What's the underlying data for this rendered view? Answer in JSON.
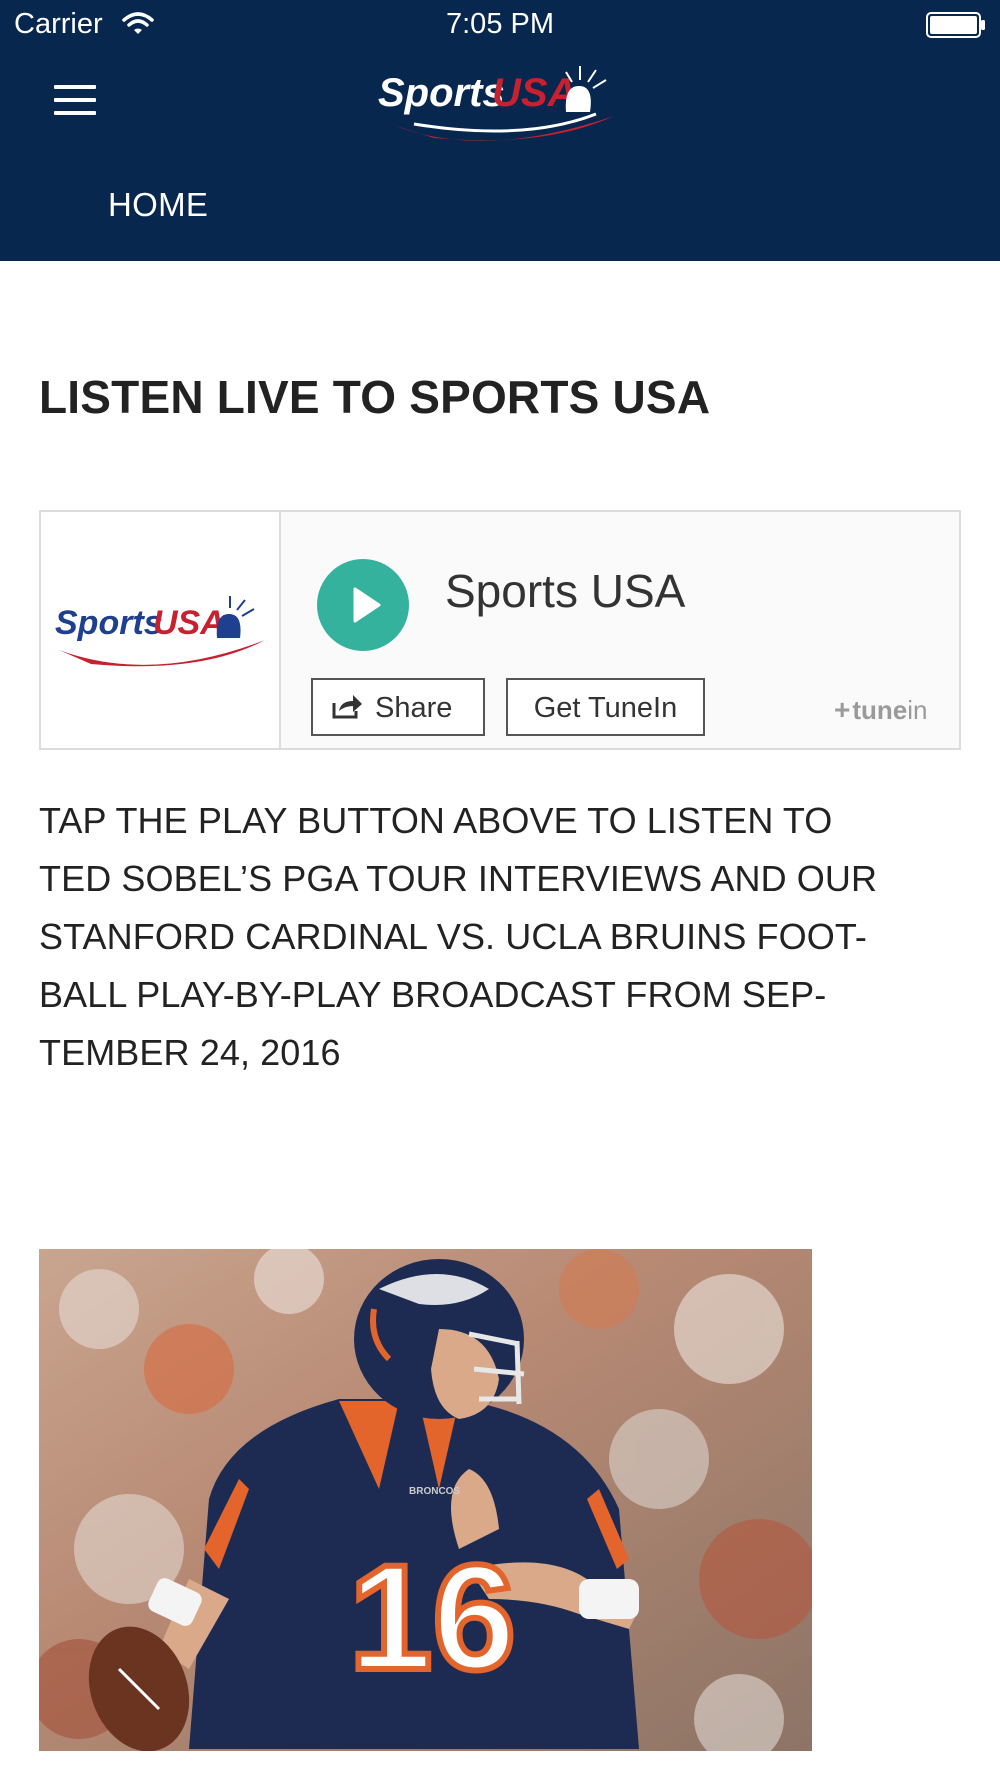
{
  "status_bar": {
    "carrier": "Carrier",
    "time": "7:05 PM"
  },
  "header": {
    "background_color": "#07274f",
    "menu_icon": "hamburger-menu-icon",
    "logo_text_sports": "Sports",
    "logo_text_usa": "USA",
    "logo_colors": {
      "blue": "#1f3f8f",
      "red": "#c8202f"
    },
    "nav": {
      "home_label": "HOME"
    }
  },
  "main": {
    "title": "LISTEN LIVE TO SPORTS USA",
    "player": {
      "station_name": "Sports USA",
      "play_icon": "play-icon",
      "play_color": "#35b29e",
      "share_label": "Share",
      "share_icon": "share-icon",
      "get_tunein_label": "Get TuneIn",
      "tunein_brand": "tune",
      "tunein_brand_in": "in"
    },
    "description_lines": [
      "TAP THE PLAY BUTTON ABOVE TO LISTEN TO",
      "TED SOBEL’S PGA TOUR INTERVIEWS AND OUR",
      "STANFORD CARDINAL VS. UCLA BRUINS FOOT-",
      "BALL PLAY-BY-PLAY BROADCAST FROM SEP-",
      "TEMBER 24, 2016"
    ],
    "image": {
      "jersey_number": "16",
      "chest_text": "BRONCOS"
    }
  }
}
